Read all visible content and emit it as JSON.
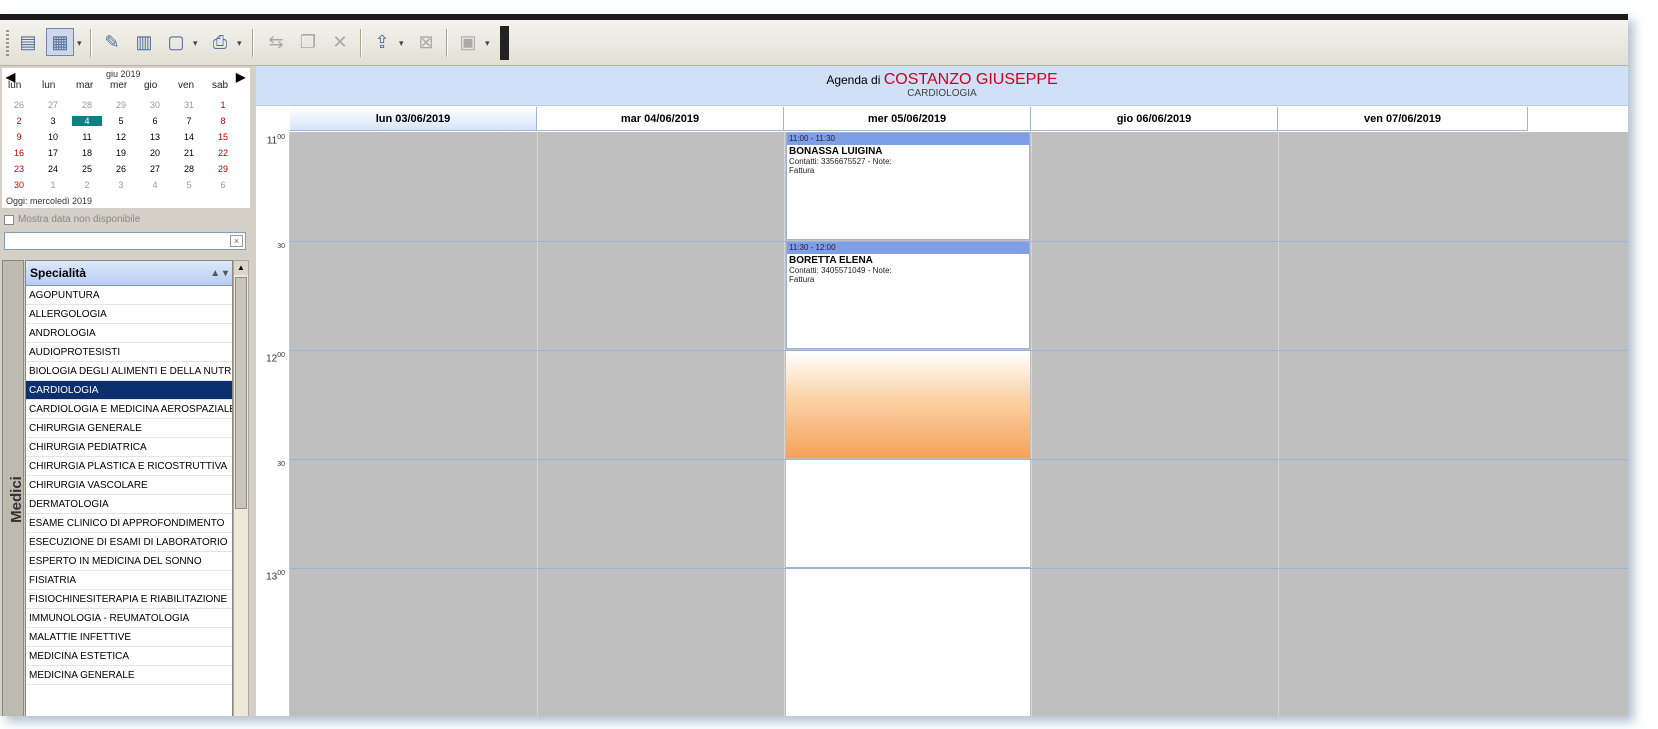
{
  "toolbar": {
    "buttons": [
      {
        "icon": "calendar-view-icon"
      },
      {
        "icon": "week-view-icon",
        "pressed": true
      },
      {
        "icon": "patient-search-icon"
      },
      {
        "icon": "document-icon"
      },
      {
        "icon": "preview-icon",
        "dropdown": true
      },
      {
        "icon": "print-icon",
        "dropdown": true
      },
      {
        "icon": "move-appointment-icon",
        "disabled": true
      },
      {
        "icon": "copy-appointment-icon",
        "disabled": true
      },
      {
        "icon": "delete-icon",
        "disabled": true
      },
      {
        "icon": "export-icon",
        "dropdown": true
      },
      {
        "icon": "excel-icon",
        "disabled": true
      },
      {
        "icon": "settings-icon",
        "dropdown": true,
        "disabled": true
      }
    ]
  },
  "calendar": {
    "month_label": "giu 2019",
    "weekdays": [
      "lun",
      "lun",
      "mar",
      "mer",
      "gio",
      "ven",
      "sab"
    ],
    "weeks": [
      [
        "26",
        "27",
        "28",
        "29",
        "30",
        "31",
        "1"
      ],
      [
        "2",
        "3",
        "4",
        "5",
        "6",
        "7",
        "8"
      ],
      [
        "9",
        "10",
        "11",
        "12",
        "13",
        "14",
        "15"
      ],
      [
        "16",
        "17",
        "18",
        "19",
        "20",
        "21",
        "22"
      ],
      [
        "23",
        "24",
        "25",
        "26",
        "27",
        "28",
        "29"
      ],
      [
        "30",
        "1",
        "2",
        "3",
        "4",
        "5",
        "6"
      ]
    ],
    "today_label": "Oggi: mercoledì 2019"
  },
  "show_days_label": "Mostra data non disponibile",
  "specialita": {
    "header": "Specialità",
    "items": [
      "AGOPUNTURA",
      "ALLERGOLOGIA",
      "ANDROLOGIA",
      "AUDIOPROTESISTI",
      "BIOLOGIA DEGLI ALIMENTI E DELLA NUTR.",
      "CARDIOLOGIA",
      "CARDIOLOGIA E MEDICINA AEROSPAZIALE",
      "CHIRURGIA GENERALE",
      "CHIRURGIA PEDIATRICA",
      "CHIRURGIA PLASTICA E RICOSTRUTTIVA",
      "CHIRURGIA VASCOLARE",
      "DERMATOLOGIA",
      "ESAME CLINICO DI APPROFONDIMENTO",
      "ESECUZIONE DI ESAMI DI LABORATORIO",
      "ESPERTO IN MEDICINA DEL SONNO",
      "FISIATRIA",
      "FISIOCHINESITERAPIA E RIABILITAZIONE",
      "IMMUNOLOGIA - REUMATOLOGIA",
      "MALATTIE INFETTIVE",
      "MEDICINA ESTETICA",
      "MEDICINA GENERALE"
    ],
    "selected": "CARDIOLOGIA"
  },
  "medici_tab": "Medici",
  "agenda": {
    "title_prefix": "Agenda di",
    "doctor": "COSTANZO GIUSEPPE",
    "specialty": "CARDIOLOGIA",
    "days": [
      "lun 03/06/2019",
      "mar 04/06/2019",
      "mer 05/06/2019",
      "gio 06/06/2019",
      "ven 07/06/2019"
    ],
    "times": [
      {
        "hour": "11",
        "min": "00"
      },
      {
        "hour": "",
        "min": "30"
      },
      {
        "hour": "12",
        "min": "00"
      },
      {
        "hour": "",
        "min": "30"
      },
      {
        "hour": "13",
        "min": "00"
      }
    ],
    "appointments": [
      {
        "slot": "11:00 - 11:30",
        "patient": "BONASSA LUIGINA",
        "contact": "Contatti: 3356675527 - Note:",
        "note": "Fattura"
      },
      {
        "slot": "11:30 - 12:00",
        "patient": "BORETTA ELENA",
        "contact": "Contatti: 3405571049 - Note:",
        "note": "Fattura"
      }
    ]
  }
}
